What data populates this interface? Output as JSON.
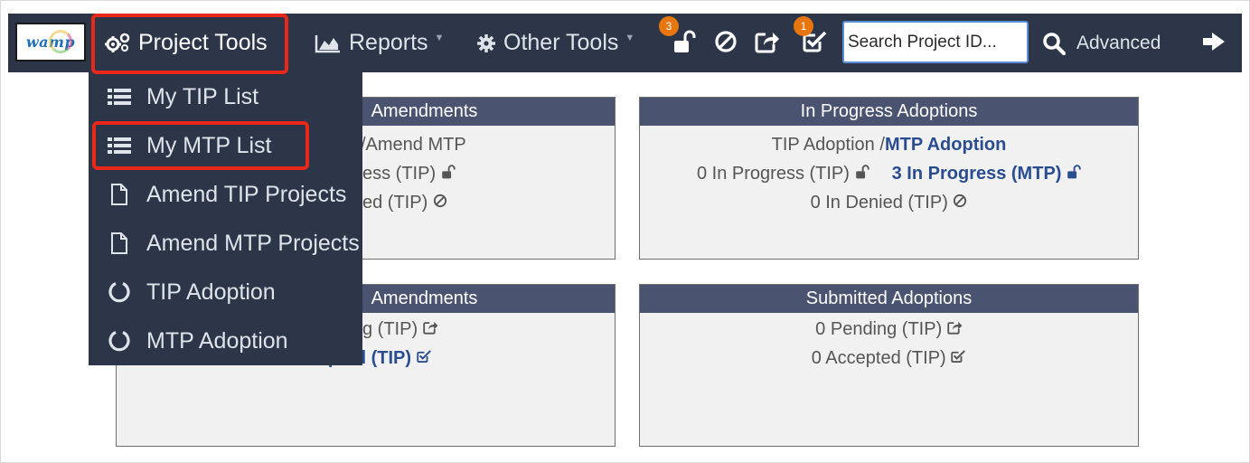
{
  "colors": {
    "navbar": "#2d3648",
    "accent_red": "#e8291a",
    "badge_orange": "#e8760f",
    "panel_header": "#4a5370",
    "link_blue": "#2a4d8f"
  },
  "logo": {
    "text": "wamp"
  },
  "nav": {
    "project_tools": "Project Tools",
    "reports": "Reports",
    "other_tools": "Other Tools"
  },
  "tool_icons": {
    "unlock_badge": "3",
    "check_badge": "1"
  },
  "search": {
    "placeholder": "Search Project ID...",
    "value": ""
  },
  "advanced_label": "Advanced",
  "dropdown_items": [
    {
      "label": "My TIP List",
      "icon": "list-icon"
    },
    {
      "label": "My MTP List",
      "icon": "list-icon"
    },
    {
      "label": "Amend TIP Projects",
      "icon": "file-icon"
    },
    {
      "label": "Amend MTP Projects",
      "icon": "file-icon"
    },
    {
      "label": "TIP Adoption",
      "icon": "circle-notch-icon"
    },
    {
      "label": "MTP Adoption",
      "icon": "circle-notch-icon"
    }
  ],
  "panels": {
    "in_progress_amendments": {
      "header_visible": "Amendments",
      "line1": "/Amend MTP",
      "line2": "ess (TIP)",
      "line3": "ed (TIP)"
    },
    "in_progress_adoptions": {
      "header": "In Progress Adoptions",
      "line1_a": "TIP Adoption",
      "line1_b": " /",
      "line1_c": "MTP Adoption",
      "line2_a": "0 In Progress (TIP)",
      "line2_b": "3 In Progress (MTP)",
      "line3": "0 In Denied (TIP)"
    },
    "submitted_amendments": {
      "header_visible": "Amendments",
      "line1": "g (TIP)",
      "line2": "Accepted (TIP)"
    },
    "submitted_adoptions": {
      "header": "Submitted Adoptions",
      "line1": "0 Pending (TIP)",
      "line2": "0 Accepted (TIP)"
    }
  }
}
